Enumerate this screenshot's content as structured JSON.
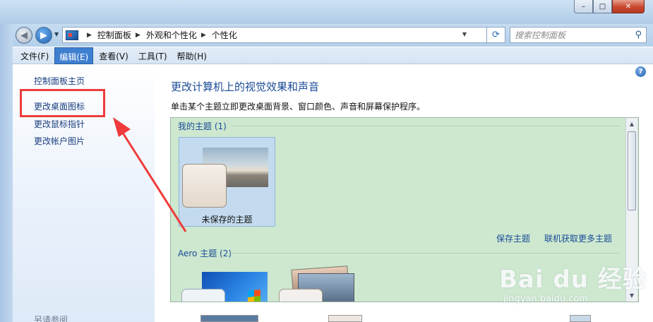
{
  "window": {
    "min_glyph": "–",
    "max_glyph": "□",
    "close_glyph": "✕"
  },
  "address": {
    "crumbs": [
      "控制面板",
      "外观和个性化",
      "个性化"
    ],
    "search_placeholder": "搜索控制面板"
  },
  "menu": {
    "items": [
      "文件(F)",
      "编辑(E)",
      "查看(V)",
      "工具(T)",
      "帮助(H)"
    ],
    "active_index": 1
  },
  "sidebar": {
    "items": [
      "控制面板主页",
      "更改桌面图标",
      "更改鼠标指针",
      "更改帐户图片"
    ],
    "see_also": "另请参阅"
  },
  "main": {
    "title": "更改计算机上的视觉效果和声音",
    "description": "单击某个主题立即更改桌面背景、窗口颜色、声音和屏幕保护程序。",
    "my_themes_label": "我的主题 (1)",
    "unsaved_theme": "未保存的主题",
    "save_theme": "保存主题",
    "get_more": "联机获取更多主题",
    "aero_label": "Aero 主题 (2)"
  },
  "watermark": {
    "brand": "Bai du 经验",
    "url": "jingyan.baidu.com"
  },
  "colors": {
    "highlight_box": "#ee3b3b",
    "arrow": "#ef3b3b",
    "link": "#1a4b96",
    "themes_bg": "#cde8cf"
  }
}
